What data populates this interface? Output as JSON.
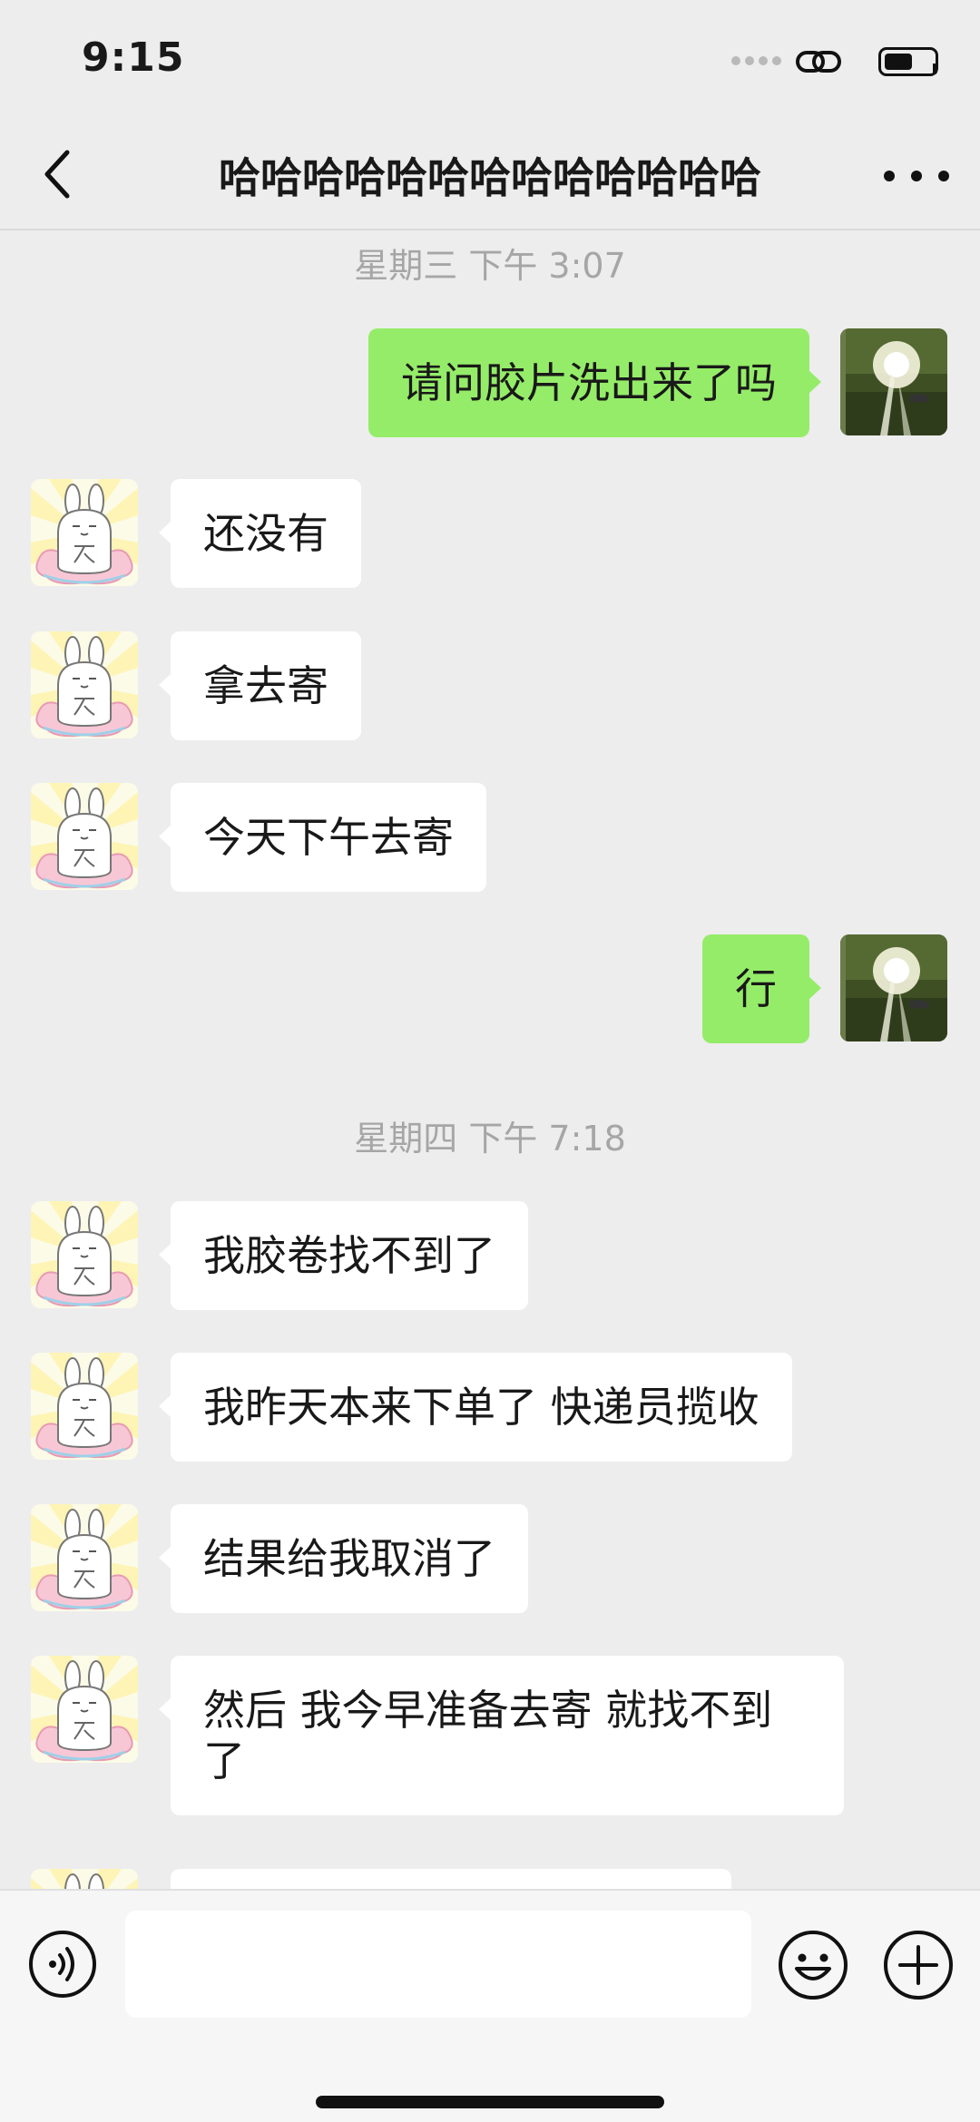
{
  "status_bar": {
    "time": "9:15",
    "battery_level": 0.55
  },
  "nav": {
    "title": "哈哈哈哈哈哈哈哈哈哈哈哈哈",
    "back_icon": "chevron-left-icon",
    "more_icon": "more-dots-icon"
  },
  "chat": {
    "timestamps": [
      "星期三 下午 3:07",
      "星期四 下午 7:18"
    ],
    "messages": [
      {
        "side": "sent",
        "text": "请问胶片洗出来了吗"
      },
      {
        "side": "received",
        "text": "还没有"
      },
      {
        "side": "received",
        "text": "拿去寄"
      },
      {
        "side": "received",
        "text": "今天下午去寄"
      },
      {
        "side": "sent",
        "text": "行"
      },
      {
        "side": "received",
        "text": "我胶卷找不到了"
      },
      {
        "side": "received",
        "text": "我昨天本来下单了 快递员揽收"
      },
      {
        "side": "received",
        "text": "结果给我取消了"
      },
      {
        "side": "received",
        "text": "然后 我今早准备去寄 就找不到了"
      },
      {
        "side": "received",
        "text": ""
      }
    ]
  },
  "toolbar": {
    "voice_icon": "voice-icon",
    "input_value": "",
    "emoji_icon": "emoji-icon",
    "plus_icon": "plus-icon"
  },
  "colors": {
    "background": "#EDEDED",
    "sent_bubble": "#95EC69",
    "received_bubble": "#FFFFFF",
    "timestamp_text": "#A6A6A6"
  }
}
